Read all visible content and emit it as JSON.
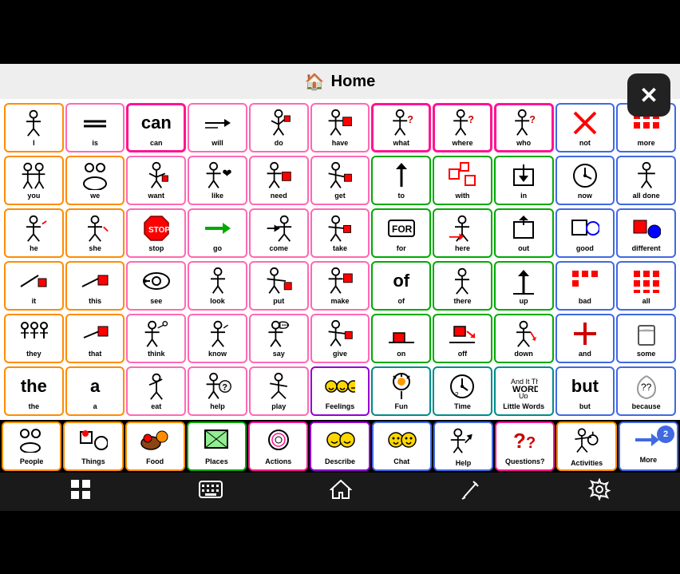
{
  "app": {
    "title": "Home",
    "close_label": "✕"
  },
  "toolbar": {
    "grid_icon": "⊞",
    "keyboard_icon": "⌨",
    "home_icon": "⌂",
    "pen_icon": "✎",
    "settings_icon": "⚙"
  },
  "header": {
    "home_icon": "🏠",
    "title": "Home"
  },
  "rows": [
    {
      "id": "row1",
      "cells": [
        {
          "label": "I",
          "color": "orange",
          "icon": "person"
        },
        {
          "label": "is",
          "color": "pink",
          "icon": "equals"
        },
        {
          "label": "can",
          "color": "pink",
          "icon": "can",
          "big": true
        },
        {
          "label": "will",
          "color": "pink",
          "icon": "arrow"
        },
        {
          "label": "do",
          "color": "pink",
          "icon": "person-action"
        },
        {
          "label": "have",
          "color": "pink",
          "icon": "person-box"
        },
        {
          "label": "what",
          "color": "green",
          "icon": "person-question"
        },
        {
          "label": "where",
          "color": "green",
          "icon": "person-question"
        },
        {
          "label": "who",
          "color": "green",
          "icon": "person-question"
        },
        {
          "label": "not",
          "color": "blue",
          "icon": "x-cross"
        },
        {
          "label": "more",
          "color": "blue",
          "icon": "dots"
        }
      ]
    },
    {
      "id": "row2",
      "cells": [
        {
          "label": "you",
          "color": "orange",
          "icon": "you-person"
        },
        {
          "label": "we",
          "color": "orange",
          "icon": "two-people"
        },
        {
          "label": "want",
          "color": "pink",
          "icon": "person-pull"
        },
        {
          "label": "like",
          "color": "pink",
          "icon": "person-heart"
        },
        {
          "label": "need",
          "color": "pink",
          "icon": "person-box2"
        },
        {
          "label": "get",
          "color": "pink",
          "icon": "person-get"
        },
        {
          "label": "to",
          "color": "green",
          "icon": "arrow-up"
        },
        {
          "label": "with",
          "color": "green",
          "icon": "with-pieces"
        },
        {
          "label": "in",
          "color": "green",
          "icon": "in-box"
        },
        {
          "label": "now",
          "color": "blue",
          "icon": "clock"
        },
        {
          "label": "all done",
          "color": "blue",
          "icon": "person-done"
        }
      ]
    },
    {
      "id": "row3",
      "cells": [
        {
          "label": "he",
          "color": "orange",
          "icon": "he-person"
        },
        {
          "label": "she",
          "color": "orange",
          "icon": "she-person"
        },
        {
          "label": "stop",
          "color": "pink",
          "icon": "stop-sign"
        },
        {
          "label": "go",
          "color": "pink",
          "icon": "arrow-right"
        },
        {
          "label": "come",
          "color": "pink",
          "icon": "come-person"
        },
        {
          "label": "take",
          "color": "pink",
          "icon": "take-box"
        },
        {
          "label": "for",
          "color": "green",
          "icon": "for-tag"
        },
        {
          "label": "here",
          "color": "green",
          "icon": "here-arrow"
        },
        {
          "label": "out",
          "color": "green",
          "icon": "out-box"
        },
        {
          "label": "good",
          "color": "blue",
          "icon": "good-sq-circle"
        },
        {
          "label": "different",
          "color": "blue",
          "icon": "diff-sq-circle"
        }
      ]
    },
    {
      "id": "row4",
      "cells": [
        {
          "label": "it",
          "color": "orange",
          "icon": "it-obj"
        },
        {
          "label": "this",
          "color": "orange",
          "icon": "this-obj"
        },
        {
          "label": "see",
          "color": "pink",
          "icon": "see-eye"
        },
        {
          "label": "look",
          "color": "pink",
          "icon": "look-person"
        },
        {
          "label": "put",
          "color": "pink",
          "icon": "put-person"
        },
        {
          "label": "make",
          "color": "pink",
          "icon": "make-box"
        },
        {
          "label": "of",
          "color": "green",
          "icon": "of-text",
          "big": true
        },
        {
          "label": "there",
          "color": "green",
          "icon": "there-person"
        },
        {
          "label": "up",
          "color": "green",
          "icon": "up-arrow"
        },
        {
          "label": "bad",
          "color": "blue",
          "icon": "bad-dots"
        },
        {
          "label": "all",
          "color": "blue",
          "icon": "all-dots"
        }
      ]
    },
    {
      "id": "row5",
      "cells": [
        {
          "label": "they",
          "color": "orange",
          "icon": "they-people"
        },
        {
          "label": "that",
          "color": "orange",
          "icon": "that-obj"
        },
        {
          "label": "think",
          "color": "pink",
          "icon": "think-person"
        },
        {
          "label": "know",
          "color": "pink",
          "icon": "know-person"
        },
        {
          "label": "say",
          "color": "pink",
          "icon": "say-person"
        },
        {
          "label": "give",
          "color": "pink",
          "icon": "give-person"
        },
        {
          "label": "on",
          "color": "green",
          "icon": "on-box"
        },
        {
          "label": "off",
          "color": "green",
          "icon": "off-arrow"
        },
        {
          "label": "down",
          "color": "green",
          "icon": "down-arrow"
        },
        {
          "label": "and",
          "color": "blue",
          "icon": "plus-cross"
        },
        {
          "label": "some",
          "color": "blue",
          "icon": "some-glass"
        }
      ]
    },
    {
      "id": "row6",
      "cells": [
        {
          "label": "the",
          "color": "orange",
          "icon": "",
          "big": true
        },
        {
          "label": "a",
          "color": "orange",
          "icon": "",
          "big": true
        },
        {
          "label": "eat",
          "color": "pink",
          "icon": "eat-person"
        },
        {
          "label": "help",
          "color": "pink",
          "icon": "help-person"
        },
        {
          "label": "play",
          "color": "pink",
          "icon": "play-person"
        },
        {
          "label": "Feelings",
          "color": "purple",
          "icon": "feelings-faces"
        },
        {
          "label": "Fun",
          "color": "teal",
          "icon": "fun-balloon"
        },
        {
          "label": "Time",
          "color": "teal",
          "icon": "time-clock"
        },
        {
          "label": "Little Words",
          "color": "teal",
          "icon": "words-text"
        },
        {
          "label": "but",
          "color": "blue",
          "icon": "",
          "big": true
        },
        {
          "label": "because",
          "color": "blue",
          "icon": "because-spiral"
        }
      ]
    }
  ],
  "nav_row": {
    "cells": [
      {
        "label": "People",
        "color": "orange",
        "icon": "people-group"
      },
      {
        "label": "Things",
        "color": "orange",
        "icon": "things-obj"
      },
      {
        "label": "Food",
        "color": "orange",
        "icon": "food-items"
      },
      {
        "label": "Places",
        "color": "green",
        "icon": "places-map"
      },
      {
        "label": "Actions",
        "color": "pink",
        "icon": "actions-cycle"
      },
      {
        "label": "Describe",
        "color": "pink",
        "icon": "describe-faces"
      },
      {
        "label": "Chat",
        "color": "blue",
        "icon": "chat-faces"
      },
      {
        "label": "Help",
        "color": "blue",
        "icon": "help-figure"
      },
      {
        "label": "Questions?",
        "color": "pink",
        "icon": "questions-marks"
      },
      {
        "label": "Activities",
        "color": "orange",
        "icon": "activities-person"
      },
      {
        "label": "More",
        "color": "blue",
        "icon": "more-arrow",
        "badge": "2"
      }
    ]
  }
}
